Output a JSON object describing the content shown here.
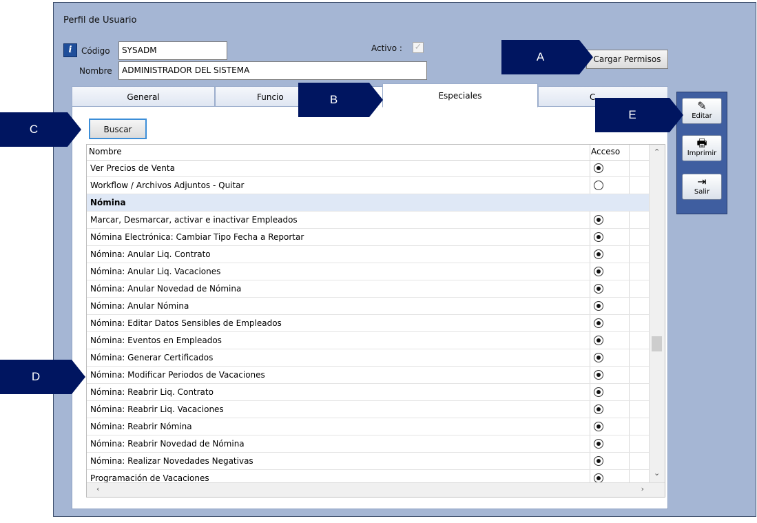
{
  "window": {
    "title": "Perfil de Usuario"
  },
  "header": {
    "codigo_label": "Código",
    "codigo_value": "SYSADM",
    "nombre_label": "Nombre",
    "nombre_value": "ADMINISTRADOR DEL SISTEMA",
    "activo_label": "Activo :",
    "activo_checked": true,
    "cargar_permisos_label": "Cargar Permisos"
  },
  "tabs": [
    "General",
    "Funcio",
    "Especiales",
    "C"
  ],
  "active_tab": "Especiales",
  "buscar_label": "Buscar",
  "grid": {
    "columns": [
      "Nombre",
      "Acceso"
    ],
    "rows": [
      {
        "name": "Ver Precios de Venta",
        "access": true,
        "group": false
      },
      {
        "name": "Workflow / Archivos Adjuntos - Quitar",
        "access": false,
        "group": false
      },
      {
        "name": "Nómina",
        "access": null,
        "group": true
      },
      {
        "name": "Marcar, Desmarcar, activar e inactivar Empleados",
        "access": true,
        "group": false
      },
      {
        "name": "Nómina Electrónica: Cambiar Tipo Fecha a Reportar",
        "access": true,
        "group": false
      },
      {
        "name": "Nómina: Anular  Liq. Contrato",
        "access": true,
        "group": false
      },
      {
        "name": "Nómina: Anular  Liq. Vacaciones",
        "access": true,
        "group": false
      },
      {
        "name": "Nómina: Anular  Novedad de Nómina",
        "access": true,
        "group": false
      },
      {
        "name": "Nómina: Anular Nómina",
        "access": true,
        "group": false
      },
      {
        "name": "Nómina: Editar Datos Sensibles de Empleados",
        "access": true,
        "group": false
      },
      {
        "name": "Nómina: Eventos en Empleados",
        "access": true,
        "group": false
      },
      {
        "name": "Nómina: Generar Certificados",
        "access": true,
        "group": false
      },
      {
        "name": "Nómina: Modificar Periodos de Vacaciones",
        "access": true,
        "group": false
      },
      {
        "name": "Nómina: Reabrir Liq. Contrato",
        "access": true,
        "group": false
      },
      {
        "name": "Nómina: Reabrir Liq. Vacaciones",
        "access": true,
        "group": false
      },
      {
        "name": "Nómina: Reabrir Nómina",
        "access": true,
        "group": false
      },
      {
        "name": "Nómina: Reabrir Novedad de Nómina",
        "access": true,
        "group": false
      },
      {
        "name": "Nómina: Realizar Novedades Negativas",
        "access": true,
        "group": false
      },
      {
        "name": "Programación de Vacaciones",
        "access": true,
        "group": false
      }
    ]
  },
  "side_buttons": [
    {
      "label": "Editar",
      "icon": "edit-icon"
    },
    {
      "label": "Imprimir",
      "icon": "printer-icon"
    },
    {
      "label": "Salir",
      "icon": "exit-icon"
    }
  ],
  "callouts": [
    "A",
    "B",
    "C",
    "D",
    "E"
  ],
  "colors": {
    "window_bg": "#a5b6d4",
    "callout_bg": "#001560",
    "side_panel": "#3f5ea0"
  }
}
